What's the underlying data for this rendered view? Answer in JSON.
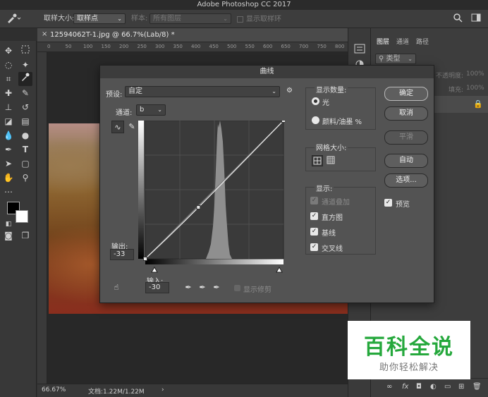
{
  "app": {
    "title": "Adobe Photoshop CC 2017"
  },
  "options_bar": {
    "sample_size_label": "取样大小:",
    "sample_size_value": "取样点",
    "sample_label": "样本:",
    "sample_value": "所有图层",
    "show_ring_label": "显示取样环"
  },
  "document": {
    "tab_label": "12594062T-1.jpg @ 66.7%(Lab/8) *",
    "close_glyph": "×",
    "ruler_marks": [
      "0",
      "50",
      "100",
      "150",
      "200",
      "250",
      "300",
      "350",
      "400",
      "450",
      "500",
      "550",
      "600",
      "650",
      "700",
      "750",
      "800"
    ]
  },
  "status": {
    "zoom": "66.67%",
    "doc_info": "文档:1.22M/1.22M",
    "arrow": "›"
  },
  "right_panel": {
    "tabs": [
      "图层",
      "通道",
      "路径"
    ],
    "kind_label": "类型",
    "opacity_label": "不透明度:",
    "opacity_value": "100%",
    "fill_label": "填充:",
    "fill_value": "100%"
  },
  "dialog": {
    "title": "曲线",
    "preset_label": "预设:",
    "preset_value": "自定",
    "channel_label": "通道:",
    "channel_value": "b",
    "output_label": "输出:",
    "output_value": "-33",
    "input_label": "输入:",
    "input_value": "-30",
    "show_clipping_label": "显示修剪",
    "display_amount_title": "显示数量:",
    "radio_light": "光",
    "radio_pigment": "颜料/油墨 %",
    "grid_size_title": "网格大小:",
    "show_title": "显示:",
    "show_options": [
      {
        "label": "通道叠加",
        "checked": true,
        "disabled": true
      },
      {
        "label": "直方图",
        "checked": true,
        "disabled": false
      },
      {
        "label": "基线",
        "checked": true,
        "disabled": false
      },
      {
        "label": "交叉线",
        "checked": true,
        "disabled": false
      }
    ],
    "buttons": {
      "ok": "确定",
      "cancel": "取消",
      "smooth": "平滑",
      "auto": "自动",
      "options": "选项..."
    },
    "preview_label": "预览",
    "curve_points": [
      {
        "input": -128,
        "output": -128
      },
      {
        "input": -30,
        "output": -33
      },
      {
        "input": 127,
        "output": 127
      }
    ]
  },
  "watermark": {
    "title": "百科全说",
    "subtitle": "助你轻松解决"
  },
  "colors": {
    "panel": "#3d3d3d",
    "dialog": "#535353",
    "watermark_green": "#25a83c"
  }
}
